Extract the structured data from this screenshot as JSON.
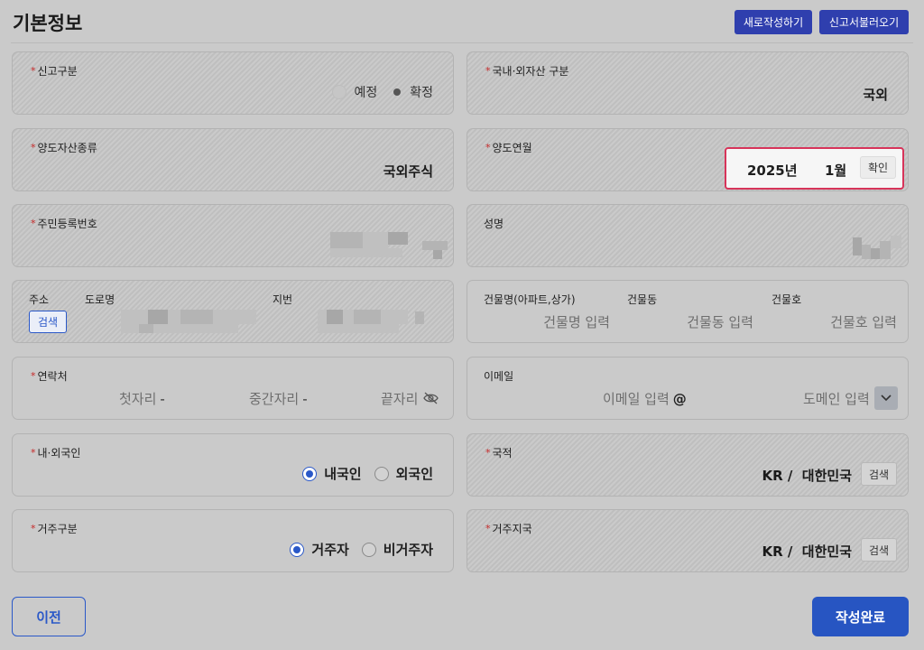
{
  "header": {
    "title": "기본정보",
    "new_btn": "새로작성하기",
    "load_btn": "신고서불러오기"
  },
  "report_type": {
    "label": "신고구분",
    "options": [
      "예정",
      "확정"
    ],
    "selected": "확정"
  },
  "asset_location": {
    "label": "국내·외자산 구분",
    "value": "국외"
  },
  "asset_type": {
    "label": "양도자산종류",
    "value": "국외주식"
  },
  "transfer_date": {
    "label": "양도연월",
    "year": "2025년",
    "month": "1월",
    "confirm_btn": "확인"
  },
  "resident_no": {
    "label": "주민등록번호"
  },
  "name": {
    "label": "성명"
  },
  "address": {
    "label": "주소",
    "search_btn": "검색",
    "road_label": "도로명",
    "lot_label": "지번"
  },
  "building": {
    "name_label": "건물명(아파트,상가)",
    "name_placeholder": "건물명 입력",
    "dong_label": "건물동",
    "dong_placeholder": "건물동 입력",
    "ho_label": "건물호",
    "ho_placeholder": "건물호 입력"
  },
  "contact": {
    "label": "연락처",
    "first_placeholder": "첫자리",
    "middle_placeholder": "중간자리",
    "last_placeholder": "끝자리",
    "separator": "-"
  },
  "email": {
    "label": "이메일",
    "id_placeholder": "이메일 입력",
    "at": "@",
    "domain_placeholder": "도메인 입력"
  },
  "citizenship": {
    "label": "내·외국인",
    "options": [
      "내국인",
      "외국인"
    ],
    "selected": "내국인"
  },
  "nationality": {
    "label": "국적",
    "value": "KR /  대한민국",
    "search_btn": "검색"
  },
  "residency": {
    "label": "거주구분",
    "options": [
      "거주자",
      "비거주자"
    ],
    "selected": "거주자"
  },
  "residence_country": {
    "label": "거주지국",
    "value": "KR /  대한민국",
    "search_btn": "검색"
  },
  "footer": {
    "prev_btn": "이전",
    "done_btn": "작성완료"
  },
  "colors": {
    "accent": "#2a58c8",
    "header_button": "#2f3fae",
    "highlight": "#d7345a",
    "required": "#c62828"
  }
}
